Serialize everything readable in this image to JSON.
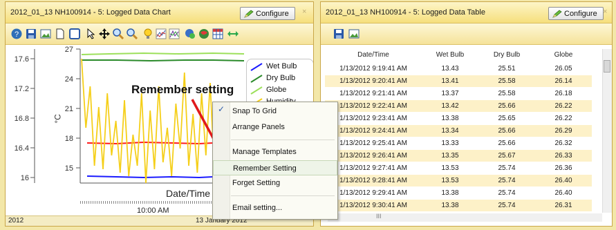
{
  "chart_panel": {
    "title": "2012_01_13 NH100914 - 5: Logged Data Chart",
    "configure_label": "Configure",
    "close": "×",
    "y_axis_label": "°C",
    "x_axis_label": "Date/Time",
    "x_tick": "10:00 AM",
    "y_left_ticks": [
      "17.6",
      "17.2",
      "16.8",
      "16.4",
      "16"
    ],
    "y_right_ticks": [
      "27",
      "24",
      "21",
      "18",
      "15"
    ],
    "legend": [
      "Wet Bulb",
      "Dry Bulb",
      "Globe",
      "Humidity"
    ],
    "status_left": "2012",
    "status_center": "13 January 2012",
    "colors": {
      "wet": "#1a1aff",
      "dry": "#2a8a2a",
      "globe": "#9ce05a",
      "humidity": "#f5cf1a",
      "red": "#ff1a1a"
    }
  },
  "table_panel": {
    "title": "2012_01_13 NH100914 - 5: Logged Data Table",
    "configure_label": "Configure",
    "close": "×",
    "columns": [
      "Date/Time",
      "Wet Bulb",
      "Dry Bulb",
      "Globe"
    ],
    "rows": [
      [
        "1/13/2012 9:19:41 AM",
        "13.43",
        "25.51",
        "26.05"
      ],
      [
        "1/13/2012 9:20:41 AM",
        "13.41",
        "25.58",
        "26.14"
      ],
      [
        "1/13/2012 9:21:41 AM",
        "13.37",
        "25.58",
        "26.18"
      ],
      [
        "1/13/2012 9:22:41 AM",
        "13.42",
        "25.66",
        "26.22"
      ],
      [
        "1/13/2012 9:23:41 AM",
        "13.38",
        "25.65",
        "26.22"
      ],
      [
        "1/13/2012 9:24:41 AM",
        "13.34",
        "25.66",
        "26.29"
      ],
      [
        "1/13/2012 9:25:41 AM",
        "13.33",
        "25.66",
        "26.32"
      ],
      [
        "1/13/2012 9:26:41 AM",
        "13.35",
        "25.67",
        "26.33"
      ],
      [
        "1/13/2012 9:27:41 AM",
        "13.53",
        "25.74",
        "26.36"
      ],
      [
        "1/13/2012 9:28:41 AM",
        "13.53",
        "25.74",
        "26.40"
      ],
      [
        "1/13/2012 9:29:41 AM",
        "13.38",
        "25.74",
        "26.40"
      ],
      [
        "1/13/2012 9:30:41 AM",
        "13.38",
        "25.74",
        "26.31"
      ]
    ],
    "scroll_dots": "III"
  },
  "context_menu": {
    "check": "✓",
    "items": [
      "Snap To Grid",
      "Arrange Panels",
      "Manage Templates",
      "Remember Setting",
      "Forget Setting",
      "Email setting..."
    ]
  },
  "annotation": "Remember setting"
}
